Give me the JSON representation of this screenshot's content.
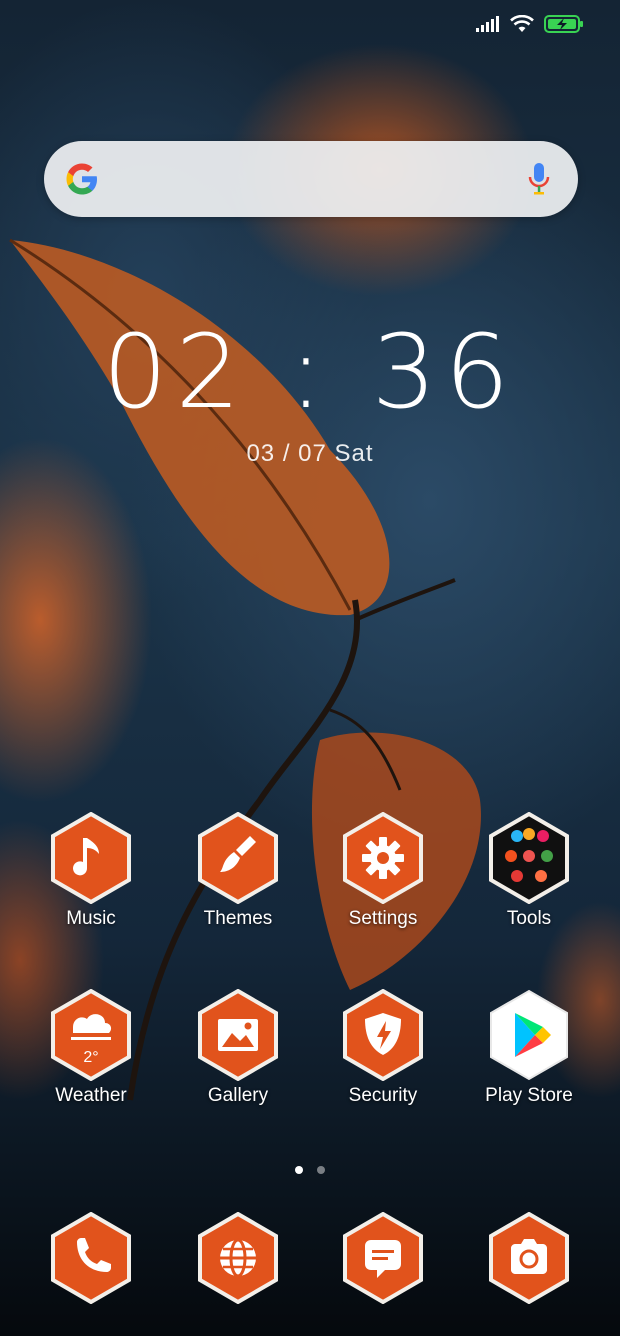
{
  "status_bar": {
    "icons": [
      "signal-icon",
      "wifi-icon",
      "battery-charging-icon"
    ],
    "battery_color": "#39d353"
  },
  "search": {
    "logo": "google-logo-icon",
    "mic": "mic-icon"
  },
  "clock": {
    "time": "02 : 36",
    "date": "03 / 07  Sat"
  },
  "theme": {
    "accent": "#e1531c",
    "hex_border": "#ffffff"
  },
  "apps": [
    {
      "label": "Music",
      "icon": "music-note-icon"
    },
    {
      "label": "Themes",
      "icon": "paintbrush-icon"
    },
    {
      "label": "Settings",
      "icon": "gear-icon"
    },
    {
      "label": "Tools",
      "icon": "tools-folder-icon"
    },
    {
      "label": "Weather",
      "icon": "weather-cloud-icon",
      "temperature": "2°"
    },
    {
      "label": "Gallery",
      "icon": "picture-icon"
    },
    {
      "label": "Security",
      "icon": "shield-bolt-icon"
    },
    {
      "label": "Play Store",
      "icon": "play-store-icon"
    }
  ],
  "page_indicator": {
    "pages": 2,
    "active": 1
  },
  "dock": [
    {
      "icon": "phone-icon"
    },
    {
      "icon": "browser-globe-icon"
    },
    {
      "icon": "messages-icon"
    },
    {
      "icon": "camera-icon"
    }
  ]
}
